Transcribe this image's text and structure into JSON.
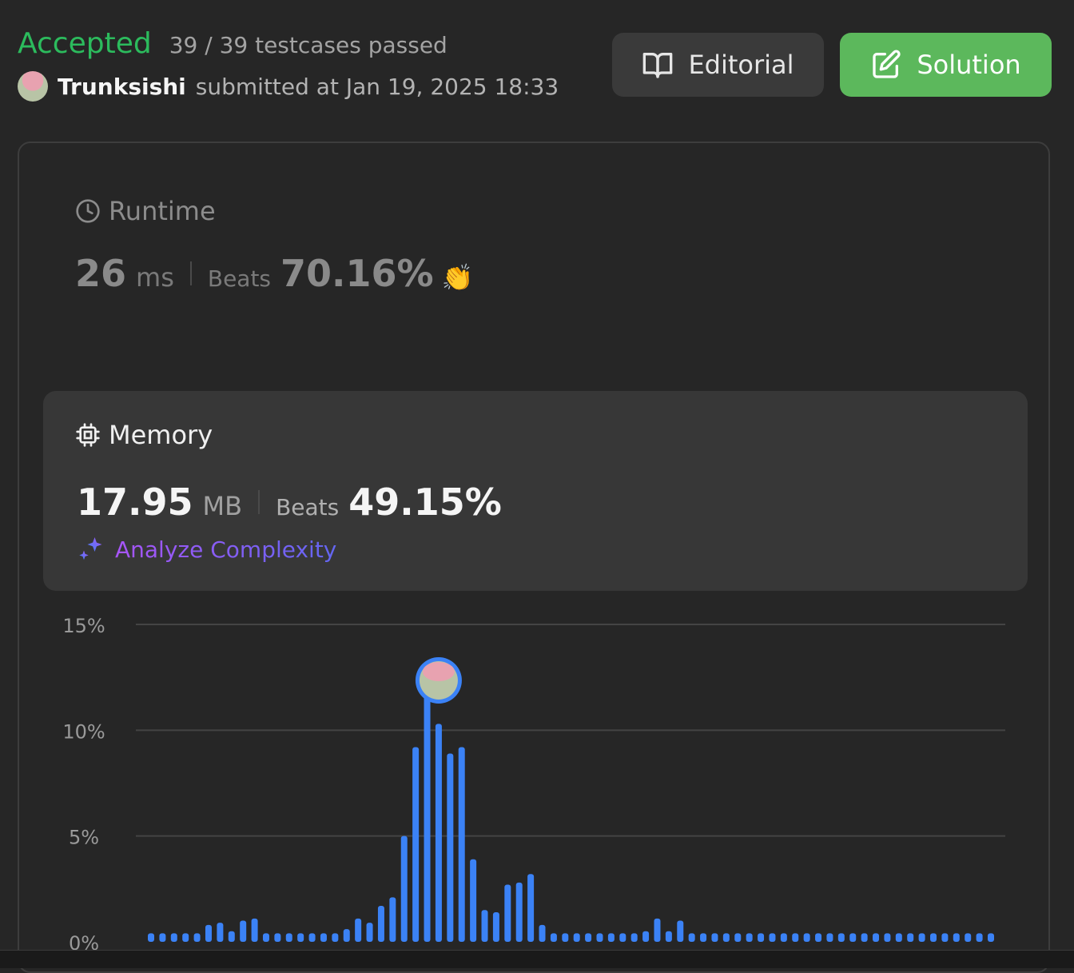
{
  "header": {
    "status": "Accepted",
    "testcases": "39 / 39 testcases passed",
    "username": "Trunksishi",
    "submitted": "submitted at Jan 19, 2025 18:33"
  },
  "buttons": {
    "editorial": "Editorial",
    "solution": "Solution"
  },
  "runtime": {
    "title": "Runtime",
    "value": "26",
    "unit": "ms",
    "beats_label": "Beats",
    "beats_value": "70.16%"
  },
  "memory": {
    "title": "Memory",
    "value": "17.95",
    "unit": "MB",
    "beats_label": "Beats",
    "beats_value": "49.15%"
  },
  "analyze": "Analyze Complexity",
  "colors": {
    "accepted": "#2cbb5d",
    "solution_button": "#5cb85c",
    "bar": "#3b82f6"
  },
  "chart_data": {
    "type": "bar",
    "ylim": [
      0,
      15
    ],
    "yticks": [
      "15%",
      "10%",
      "5%",
      "0%"
    ],
    "grid": true,
    "highlight_index": 25,
    "values": [
      0.4,
      0.4,
      0.4,
      0.4,
      0.4,
      0.8,
      0.9,
      0.5,
      1.0,
      1.1,
      0.4,
      0.4,
      0.4,
      0.4,
      0.4,
      0.4,
      0.4,
      0.6,
      1.1,
      0.9,
      1.7,
      2.1,
      5.0,
      9.2,
      11.9,
      10.3,
      8.9,
      9.2,
      3.9,
      1.5,
      1.4,
      2.7,
      2.8,
      3.2,
      0.8,
      0.4,
      0.4,
      0.4,
      0.4,
      0.4,
      0.4,
      0.4,
      0.4,
      0.5,
      1.1,
      0.5,
      1.0,
      0.4,
      0.4,
      0.4,
      0.4,
      0.4,
      0.4,
      0.4,
      0.4,
      0.4,
      0.4,
      0.4,
      0.4,
      0.4,
      0.4,
      0.4,
      0.4,
      0.4,
      0.4,
      0.4,
      0.4,
      0.4,
      0.4,
      0.4,
      0.4,
      0.4,
      0.4,
      0.4
    ]
  }
}
